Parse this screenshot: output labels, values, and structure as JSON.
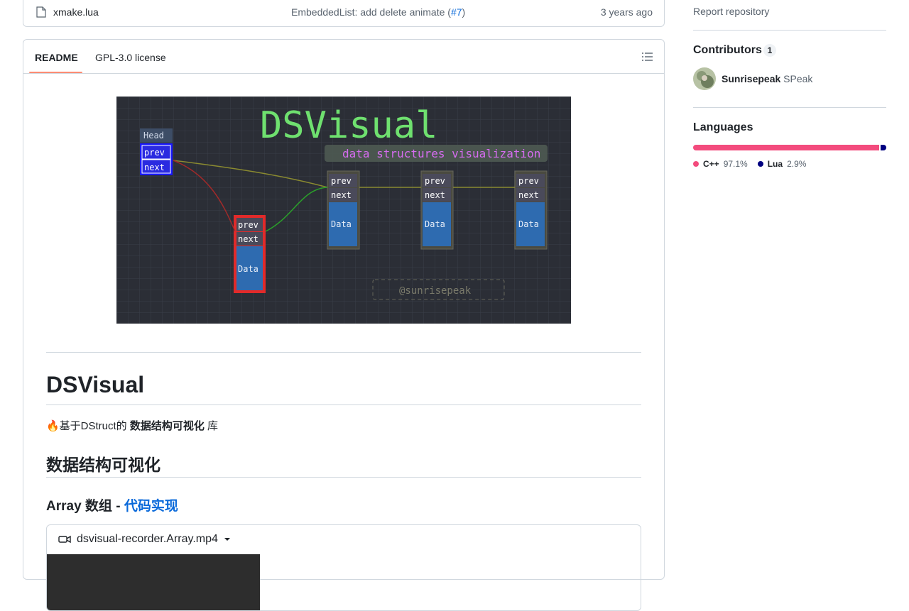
{
  "file_row": {
    "name": "xmake.lua",
    "commit_prefix": "EmbeddedList: add delete animate (",
    "commit_link": "#7",
    "commit_suffix": ")",
    "age": "3 years ago"
  },
  "readme_tabs": {
    "readme": "README",
    "license": "GPL-3.0 license"
  },
  "banner": {
    "title": "DSVisual",
    "subtitle": "data structures visualization",
    "head_label": "Head",
    "prev": "prev",
    "next": "next",
    "data": "Data",
    "watermark": "@sunrisepeak",
    "colors": {
      "bg": "#2b2e36",
      "title": "#6fe06f",
      "subtitle": "#d66cf0",
      "node": "#2e6bb0",
      "head_node": "#1a1aff",
      "new_node": "#e22a2a"
    }
  },
  "readme": {
    "h1": "DSVisual",
    "intro_prefix": "🔥基于DStruct的 ",
    "intro_bold": "数据结构可视化",
    "intro_suffix": " 库",
    "h2": "数据结构可视化",
    "h3_prefix": "Array 数组 - ",
    "h3_link": "代码实现",
    "video_name": "dsvisual-recorder.Array.mp4"
  },
  "sidebar": {
    "report": "Report repository",
    "contributors_title": "Contributors",
    "contributors_count": "1",
    "contributor_login": "Sunrisepeak",
    "contributor_name": "SPeak",
    "languages_title": "Languages",
    "languages": [
      {
        "name": "C++",
        "percent": "97.1%",
        "value": 97.1,
        "color": "#f34b7d"
      },
      {
        "name": "Lua",
        "percent": "2.9%",
        "value": 2.9,
        "color": "#000080"
      }
    ]
  }
}
